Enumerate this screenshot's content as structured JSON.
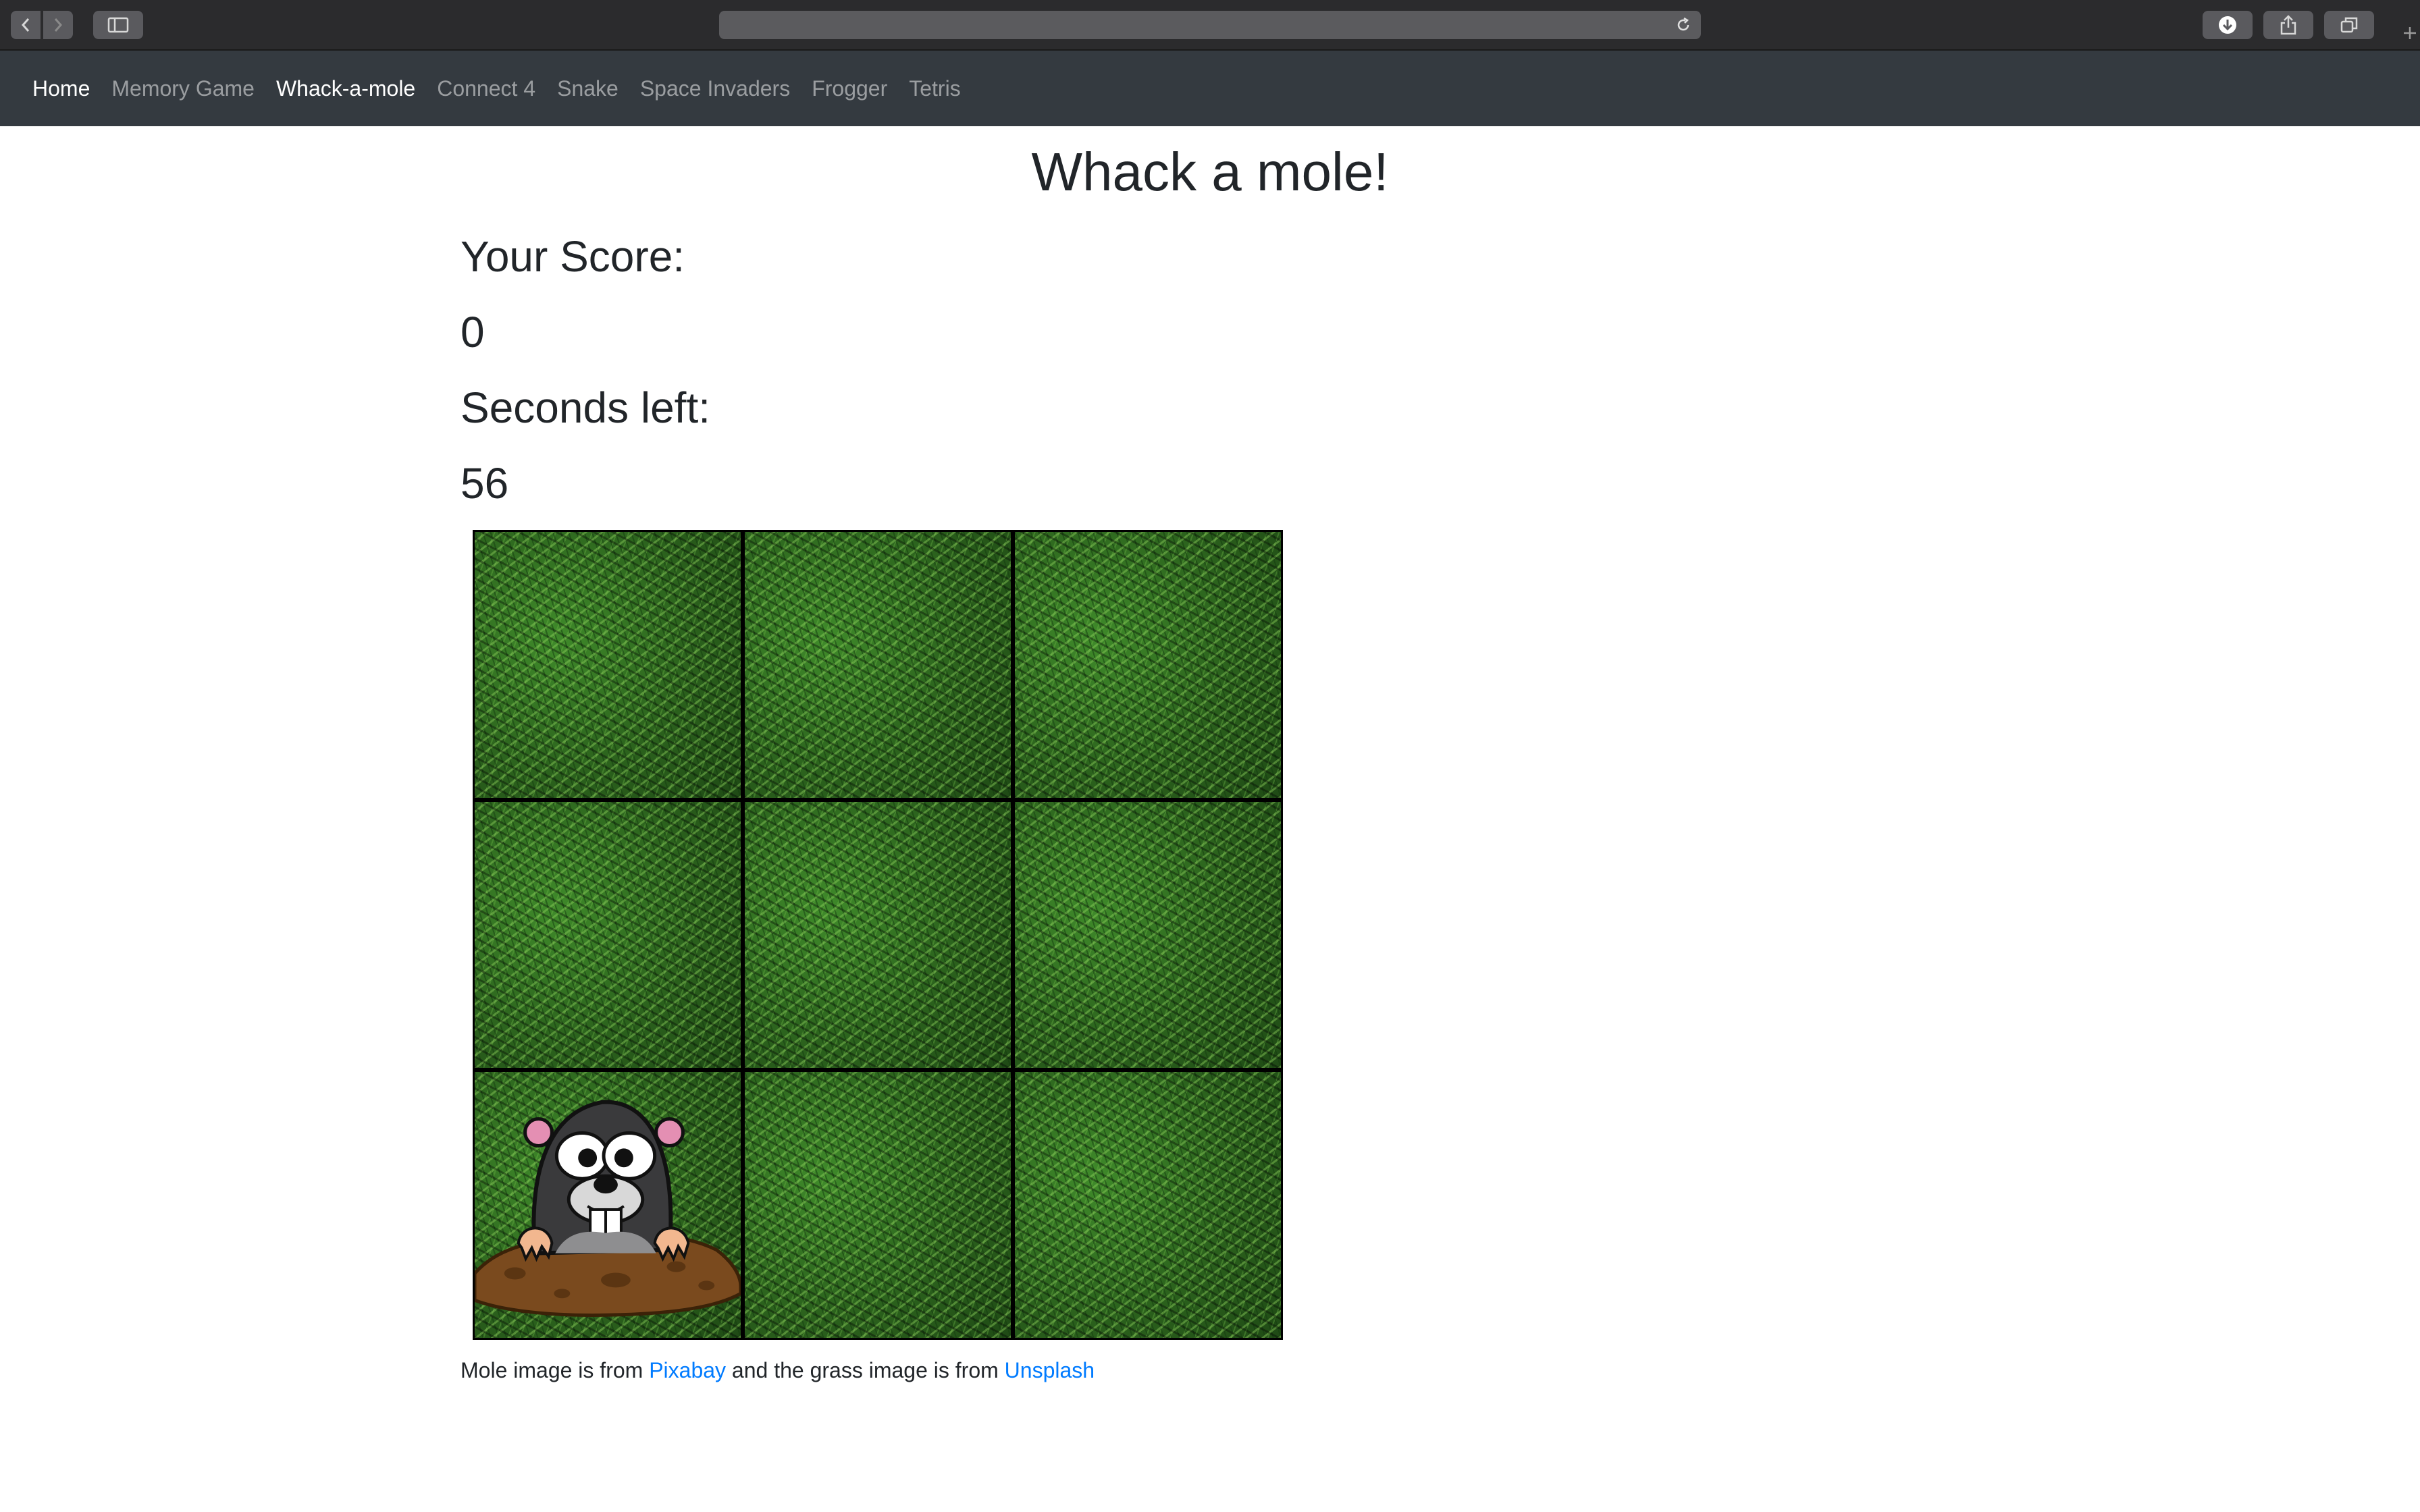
{
  "browser": {
    "address": "",
    "icons": [
      "back-icon",
      "forward-icon",
      "sidebar-icon",
      "reload-icon",
      "download-icon",
      "share-icon",
      "tabs-icon",
      "new-tab-icon"
    ]
  },
  "nav": {
    "brand": "Home",
    "links": [
      "Memory Game",
      "Whack-a-mole",
      "Connect 4",
      "Snake",
      "Space Invaders",
      "Frogger",
      "Tetris"
    ],
    "active": "Whack-a-mole"
  },
  "page": {
    "title": "Whack a mole!",
    "score_label": "Your Score:",
    "score_value": "0",
    "seconds_label": "Seconds left:",
    "seconds_value": "56"
  },
  "game": {
    "grid": "3x3",
    "mole_square": 7,
    "squares": [
      1,
      2,
      3,
      4,
      5,
      6,
      7,
      8,
      9
    ]
  },
  "credit": {
    "prefix": "Mole image is from ",
    "link1": "Pixabay",
    "middle": " and the grass image is from ",
    "link2": "Unsplash"
  },
  "colors": {
    "navbar": "#343a40",
    "link": "#007bff",
    "text": "#212529"
  }
}
